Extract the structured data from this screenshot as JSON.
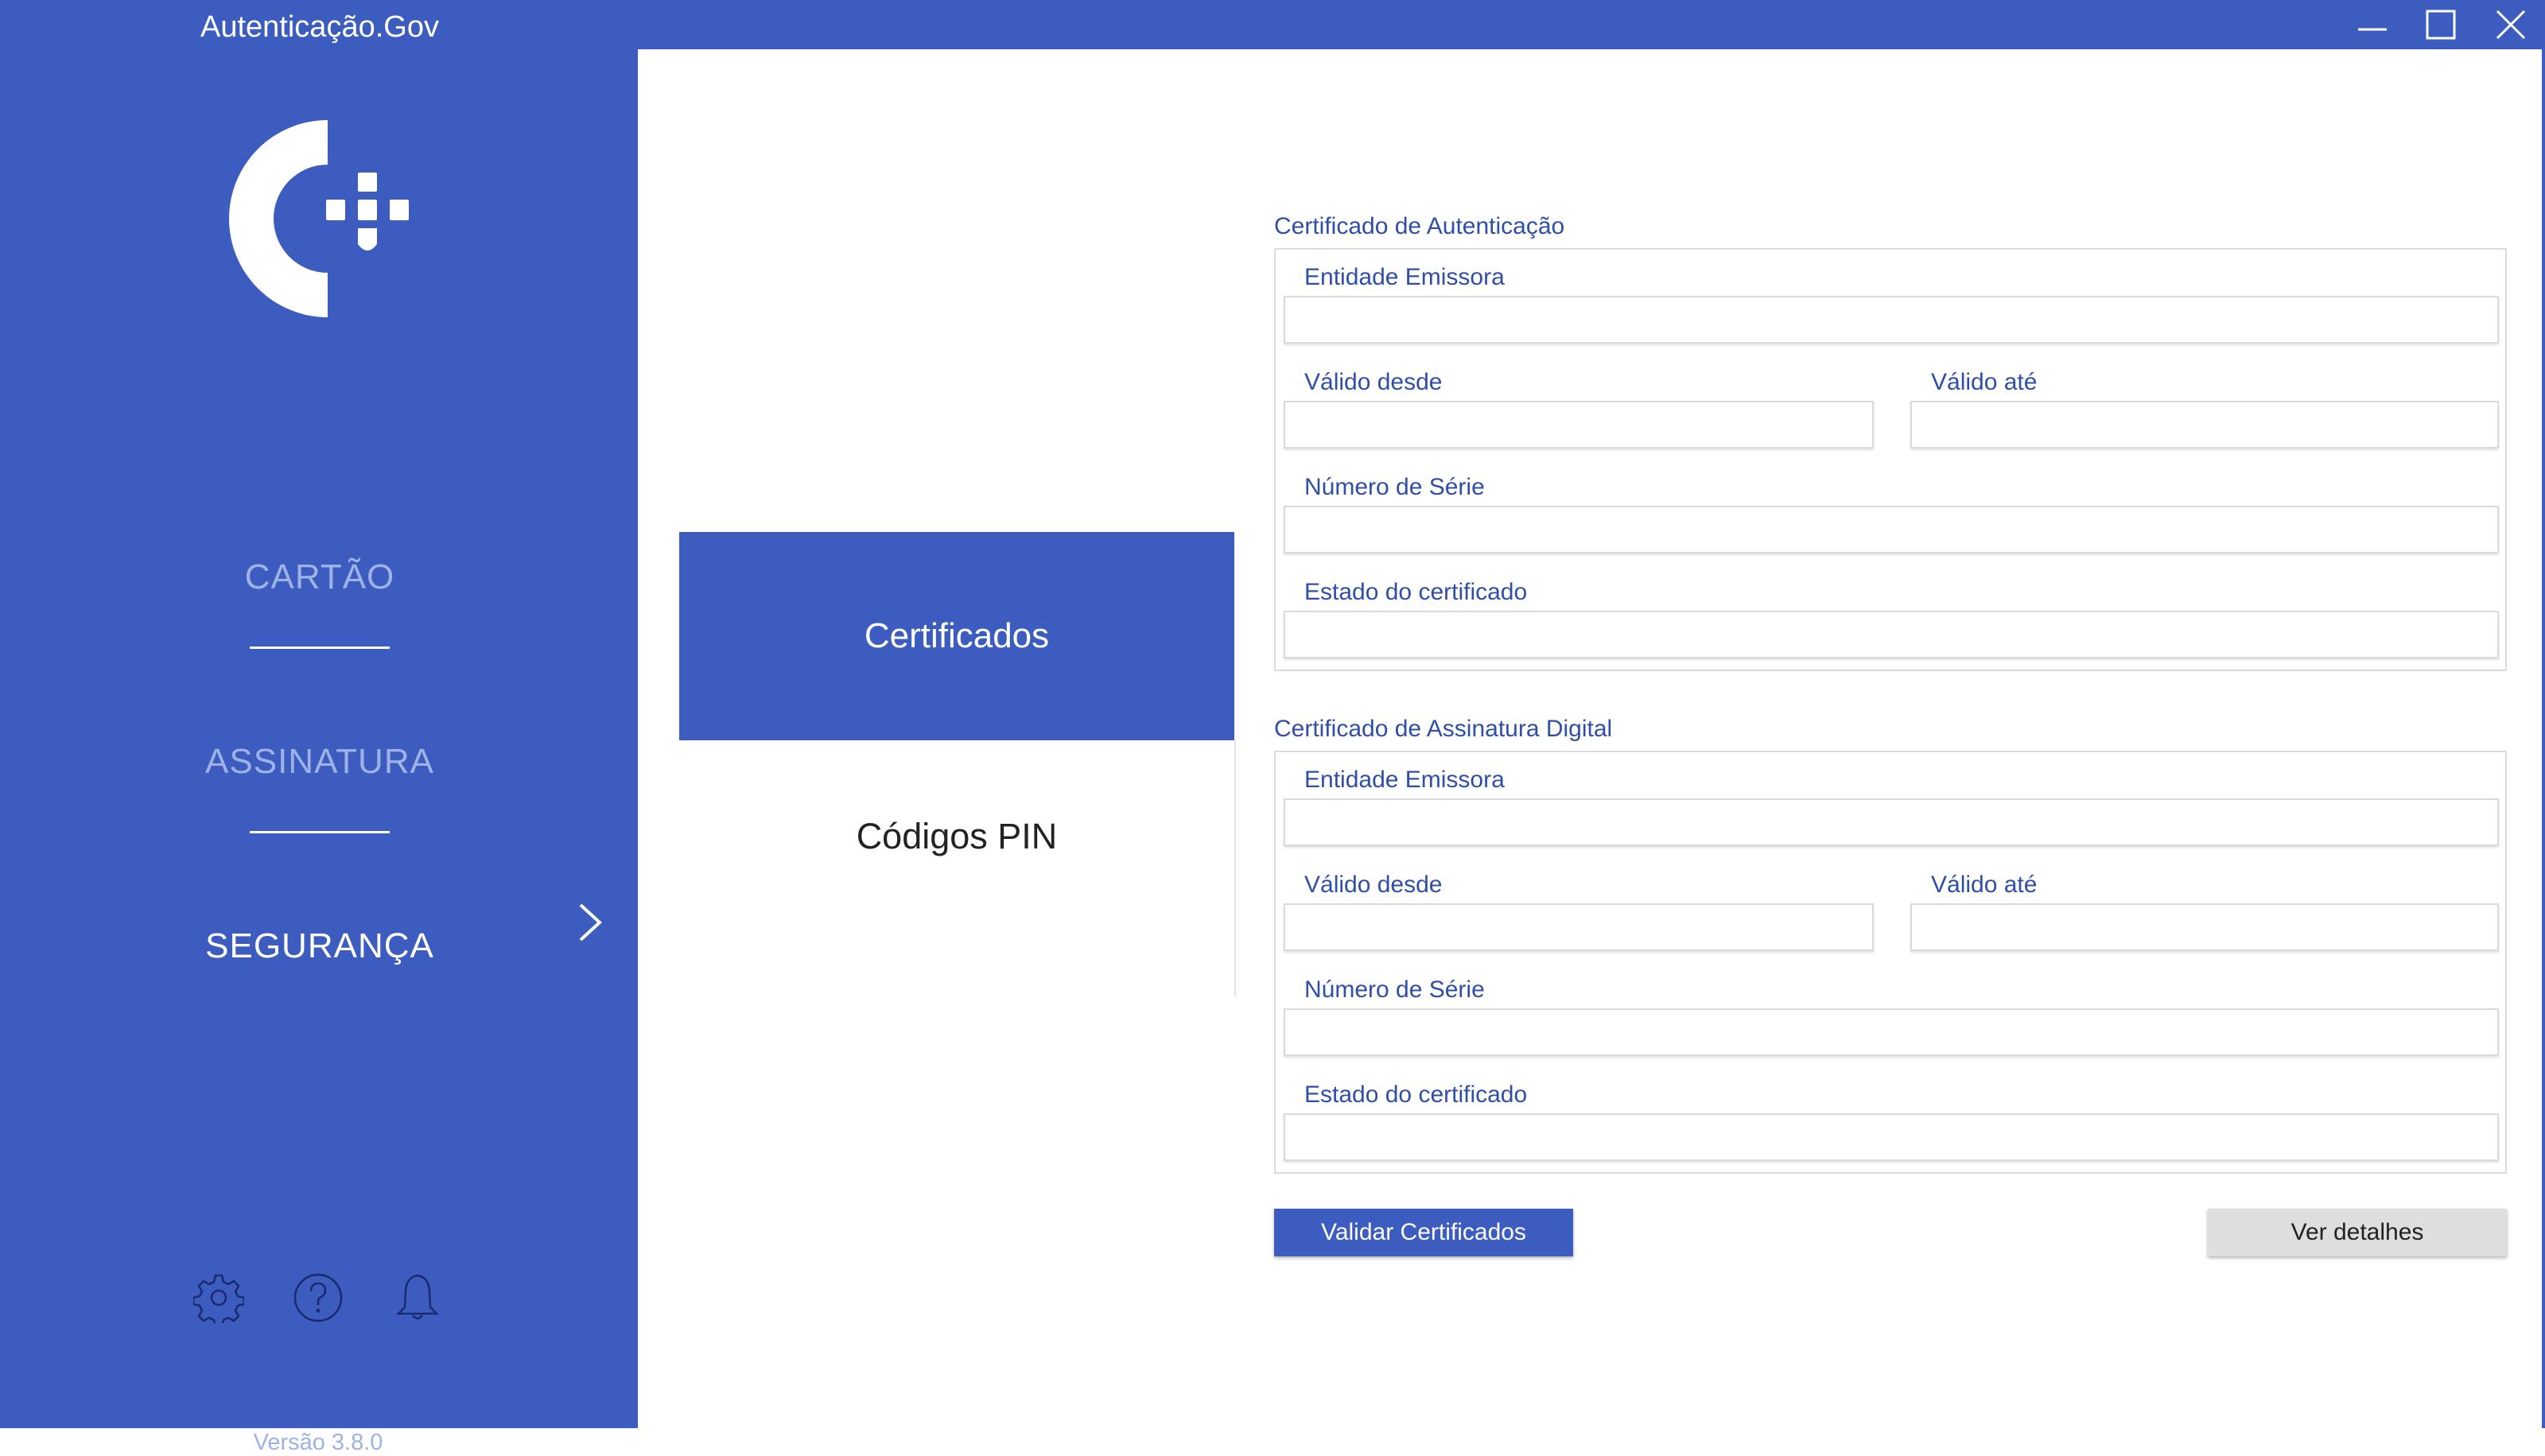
{
  "window": {
    "title": "Autenticação.Gov",
    "controls": [
      "minimize-icon",
      "maximize-icon",
      "close-icon"
    ]
  },
  "theme": {
    "primary": "#3c5dbf",
    "nav_inactive": "#9fb2e6",
    "label_blue": "#2f4ea8",
    "secondary_button": "#dedede"
  },
  "sidebar": {
    "logo": "autenticacao-gov-logo",
    "nav": [
      {
        "label": "CARTÃO",
        "active": false
      },
      {
        "label": "ASSINATURA",
        "active": false
      },
      {
        "label": "SEGURANÇA",
        "active": true
      }
    ],
    "footer_icons": [
      "gear-icon",
      "help-icon",
      "bell-icon"
    ],
    "version": "Versão 3.8.0"
  },
  "submenu": {
    "items": [
      {
        "label": "Certificados",
        "active": true
      },
      {
        "label": "Códigos PIN",
        "active": false
      }
    ]
  },
  "auth_cert": {
    "title": "Certificado de Autenticação",
    "issuer_label": "Entidade Emissora",
    "issuer_value": "",
    "valid_from_label": "Válido desde",
    "valid_from_value": "",
    "valid_to_label": "Válido até",
    "valid_to_value": "",
    "serial_label": "Número de Série",
    "serial_value": "",
    "status_label": "Estado do certificado",
    "status_value": ""
  },
  "sign_cert": {
    "title": "Certificado de Assinatura Digital",
    "issuer_label": "Entidade Emissora",
    "issuer_value": "",
    "valid_from_label": "Válido desde",
    "valid_from_value": "",
    "valid_to_label": "Válido até",
    "valid_to_value": "",
    "serial_label": "Número de Série",
    "serial_value": "",
    "status_label": "Estado do certificado",
    "status_value": ""
  },
  "actions": {
    "validate_label": "Validar Certificados",
    "details_label": "Ver detalhes"
  }
}
